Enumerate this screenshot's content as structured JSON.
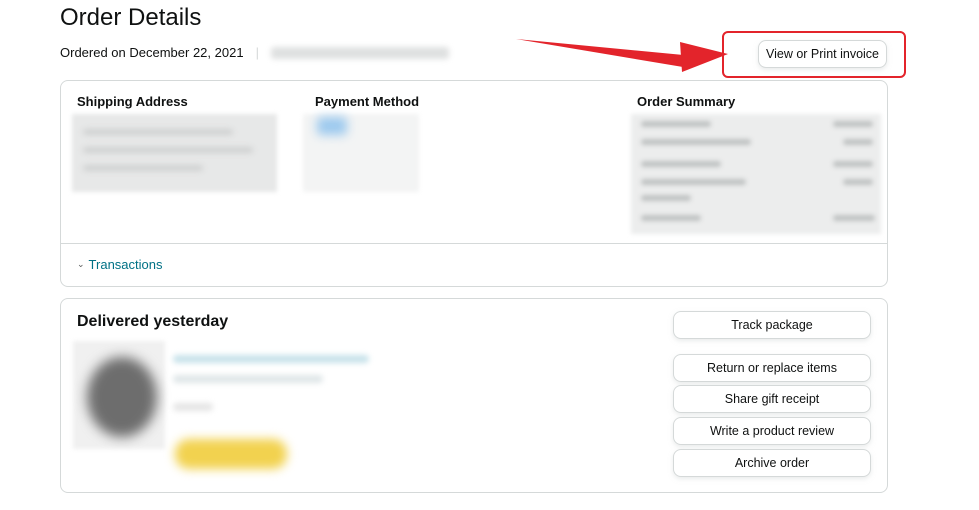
{
  "page": {
    "title": "Order Details",
    "ordered_on": "Ordered on December 22, 2021",
    "separator": "|"
  },
  "actions": {
    "invoice_label": "View or Print invoice"
  },
  "summary_card": {
    "shipping_heading": "Shipping Address",
    "payment_heading": "Payment Method",
    "order_summary_heading": "Order Summary",
    "transactions_label": "Transactions",
    "chevron_icon": "chevron-down-icon"
  },
  "shipment_card": {
    "status_heading": "Delivered yesterday",
    "buttons": {
      "track": "Track package",
      "return": "Return or replace items",
      "gift": "Share gift receipt",
      "review": "Write a product review",
      "archive": "Archive order"
    }
  },
  "colors": {
    "highlight": "#e3242b",
    "link": "#007185",
    "border": "#d5d9d9",
    "text": "#0f1111"
  }
}
